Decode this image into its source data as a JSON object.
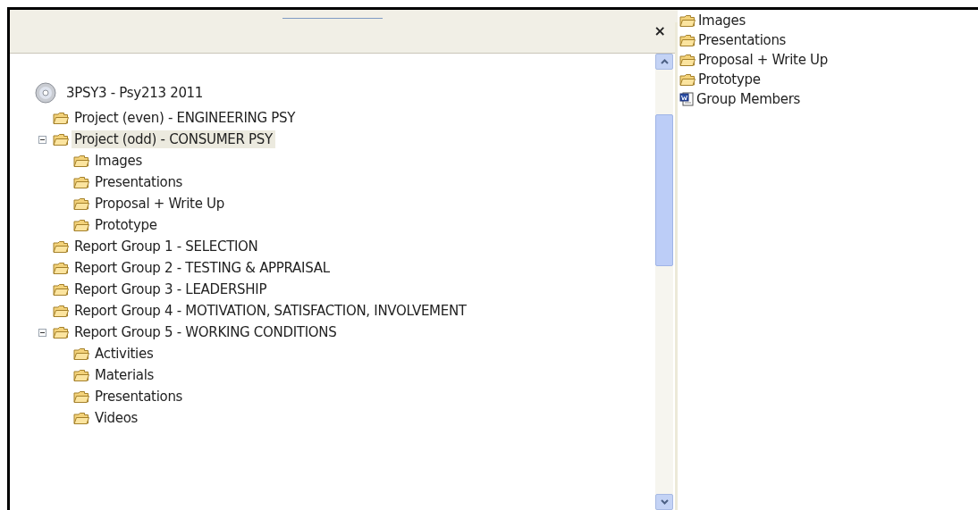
{
  "tree": {
    "label": "3PSY3 - Psy213 2011",
    "kind": "disc",
    "children": [
      {
        "label": "Project (even) - ENGINEERING PSY",
        "kind": "folder",
        "selected": false,
        "expanded": false
      },
      {
        "label": "Project (odd) - CONSUMER PSY",
        "kind": "folder",
        "selected": true,
        "expanded": true,
        "children": [
          {
            "label": "Images",
            "kind": "folder",
            "selected": false,
            "expanded": false
          },
          {
            "label": "Presentations",
            "kind": "folder",
            "selected": false,
            "expanded": false
          },
          {
            "label": "Proposal + Write Up",
            "kind": "folder",
            "selected": false,
            "expanded": false
          },
          {
            "label": "Prototype",
            "kind": "folder",
            "selected": false,
            "expanded": false
          }
        ]
      },
      {
        "label": "Report Group 1 - SELECTION",
        "kind": "folder",
        "selected": false,
        "expanded": false
      },
      {
        "label": "Report Group 2 - TESTING & APPRAISAL",
        "kind": "folder",
        "selected": false,
        "expanded": false
      },
      {
        "label": "Report Group 3 - LEADERSHIP",
        "kind": "folder",
        "selected": false,
        "expanded": false
      },
      {
        "label": "Report Group 4 - MOTIVATION, SATISFACTION, INVOLVEMENT",
        "kind": "folder",
        "selected": false,
        "expanded": false
      },
      {
        "label": "Report Group 5 - WORKING CONDITIONS",
        "kind": "folder",
        "selected": false,
        "expanded": true,
        "children": [
          {
            "label": "Activities",
            "kind": "folder",
            "selected": false,
            "expanded": false
          },
          {
            "label": "Materials",
            "kind": "folder",
            "selected": false,
            "expanded": false
          },
          {
            "label": "Presentations",
            "kind": "folder",
            "selected": false,
            "expanded": false
          },
          {
            "label": "Videos",
            "kind": "folder",
            "selected": false,
            "expanded": false
          }
        ]
      }
    ]
  },
  "close_button": "×",
  "contents": [
    {
      "label": "Images",
      "kind": "folder"
    },
    {
      "label": "Presentations",
      "kind": "folder"
    },
    {
      "label": "Proposal + Write Up",
      "kind": "folder"
    },
    {
      "label": "Prototype",
      "kind": "folder"
    },
    {
      "label": "Group Members",
      "kind": "document"
    }
  ]
}
